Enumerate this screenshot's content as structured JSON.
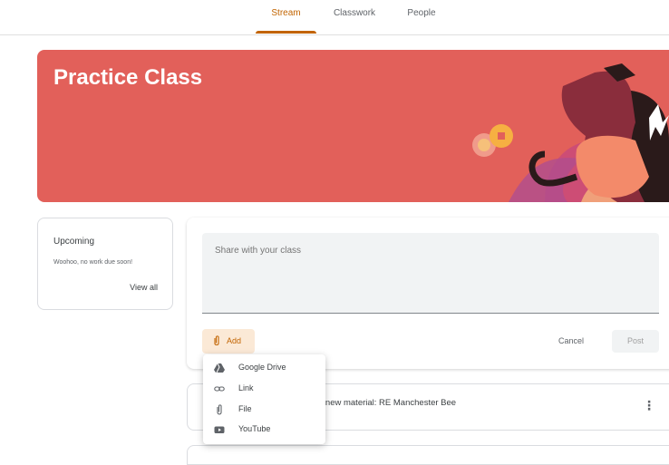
{
  "nav": {
    "tabs": [
      {
        "label": "Stream",
        "active": true
      },
      {
        "label": "Classwork",
        "active": false
      },
      {
        "label": "People",
        "active": false
      }
    ]
  },
  "banner": {
    "title": "Practice Class",
    "color": "#e2605a"
  },
  "upcoming": {
    "title": "Upcoming",
    "subtitle": "Woohoo, no work due soon!",
    "view_all": "View all"
  },
  "share": {
    "placeholder": "Share with your class",
    "add_label": "Add",
    "cancel_label": "Cancel",
    "post_label": "Post"
  },
  "add_menu": {
    "items": [
      {
        "label": "Google Drive",
        "icon": "google-drive-icon"
      },
      {
        "label": "Link",
        "icon": "link-icon"
      },
      {
        "label": "File",
        "icon": "paperclip-icon"
      },
      {
        "label": "YouTube",
        "icon": "youtube-icon"
      }
    ]
  },
  "stream": {
    "items": [
      {
        "text": "a new material: RE Manchester Bee",
        "more_icon": "more-vert-icon"
      }
    ]
  },
  "colors": {
    "accent": "#c26401",
    "accent_light": "#fbe9d6"
  }
}
